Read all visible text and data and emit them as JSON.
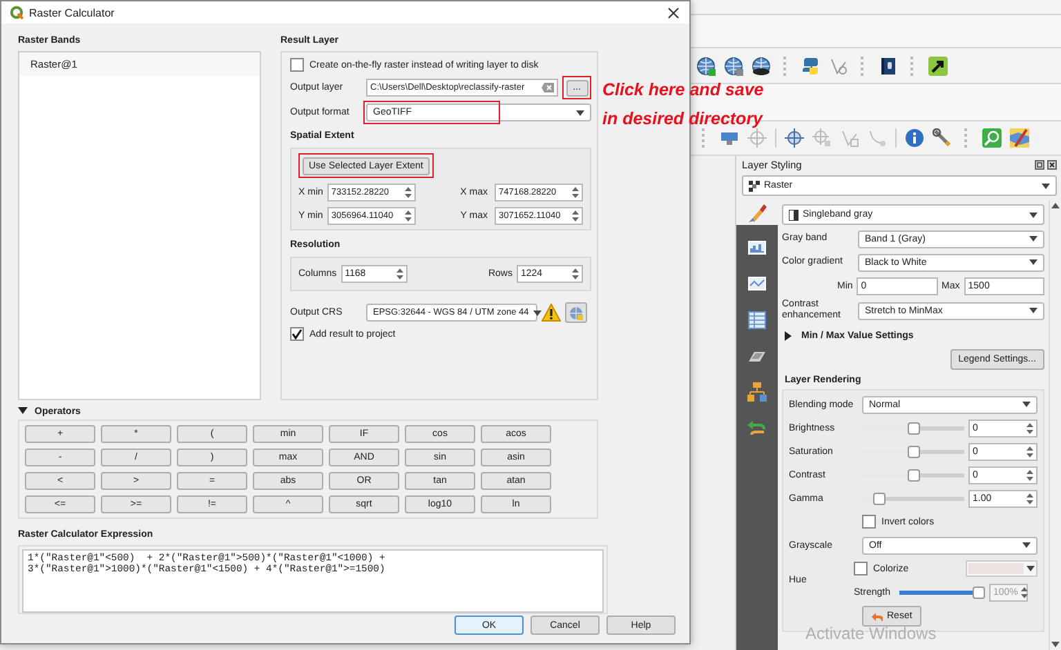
{
  "dialog": {
    "title": "Raster Calculator",
    "raster_bands": {
      "heading": "Raster Bands",
      "items": [
        {
          "label": "Raster@1",
          "selected": false
        }
      ]
    },
    "result_layer": {
      "heading": "Result Layer",
      "on_the_fly": {
        "label": "Create on-the-fly raster instead of writing layer to disk",
        "checked": false
      },
      "output_layer": {
        "label": "Output layer",
        "value": "C:\\Users\\Dell\\Desktop\\reclassify-raster",
        "browse": "...",
        "browse_highlighted": true
      },
      "output_format": {
        "label": "Output format",
        "value": "GeoTIFF",
        "highlighted": true
      },
      "spatial_extent": {
        "heading": "Spatial Extent",
        "button": "Use Selected Layer Extent",
        "button_highlighted": true,
        "fields": [
          {
            "label": "X min",
            "value": "733152.28220"
          },
          {
            "label": "X max",
            "value": "747168.28220"
          },
          {
            "label": "Y min",
            "value": "3056964.11040"
          },
          {
            "label": "Y max",
            "value": "3071652.11040"
          }
        ]
      },
      "resolution": {
        "heading": "Resolution",
        "fields": [
          {
            "label": "Columns",
            "value": "1168"
          },
          {
            "label": "Rows",
            "value": "1224"
          }
        ]
      },
      "output_crs": {
        "label": "Output CRS",
        "value": "EPSG:32644 - WGS 84 / UTM zone 44"
      },
      "add_to_project": {
        "label": "Add result to project",
        "checked": true
      }
    },
    "operators": {
      "heading": "Operators",
      "expanded": true,
      "buttons": [
        "+",
        "*",
        "(",
        "min",
        "IF",
        "cos",
        "acos",
        "-",
        "/",
        ")",
        "max",
        "AND",
        "sin",
        "asin",
        "<",
        ">",
        "=",
        "abs",
        "OR",
        "tan",
        "atan",
        "<=",
        ">=",
        "!=",
        "^",
        "sqrt",
        "log10",
        "ln"
      ]
    },
    "expression": {
      "heading": "Raster Calculator Expression",
      "lines": [
        "1*(\"Raster@1\"<500)  + 2*(\"Raster@1\">500)*(\"Raster@1\"<1000) +",
        "3*(\"Raster@1\">1000)*(\"Raster@1\"<1500) + 4*(\"Raster@1\">=1500)"
      ]
    },
    "buttons": [
      {
        "label": "OK",
        "default": true
      },
      {
        "label": "Cancel",
        "default": false
      },
      {
        "label": "Help",
        "default": false
      }
    ]
  },
  "annotation": {
    "lines": [
      "Click here and save",
      "in desired directory"
    ]
  },
  "layer_styling": {
    "title": "Layer Styling",
    "layer": "Raster",
    "sidebar_tabs": [
      {
        "selected": true
      },
      {
        "selected": false
      },
      {
        "selected": false
      },
      {
        "selected": false
      },
      {
        "selected": false
      },
      {
        "selected": false
      },
      {
        "selected": false
      }
    ],
    "renderer": "Singleband gray",
    "rows": [
      {
        "kind": "combo",
        "label": "Gray band",
        "value": "Band 1 (Gray)"
      },
      {
        "kind": "combo",
        "label": "Color gradient",
        "value": "Black to White"
      },
      {
        "kind": "minmax",
        "min_label": "Min",
        "min": "0",
        "max_label": "Max",
        "max": "1500"
      },
      {
        "kind": "combo",
        "label": "Contrast enhancement",
        "value": "Stretch to MinMax"
      }
    ],
    "minmax_settings": {
      "label": "Min / Max Value Settings",
      "expanded": false
    },
    "legend_button": "Legend Settings...",
    "rendering": {
      "heading": "Layer Rendering",
      "blending": {
        "label": "Blending mode",
        "value": "Normal"
      },
      "sliders": [
        {
          "label": "Brightness",
          "level": 0.5,
          "value": "0"
        },
        {
          "label": "Saturation",
          "level": 0.5,
          "value": "0"
        },
        {
          "label": "Contrast",
          "level": 0.5,
          "value": "0"
        },
        {
          "label": "Gamma",
          "level": 0.13,
          "value": "1.00"
        }
      ],
      "invert": {
        "label": "Invert colors",
        "checked": false
      },
      "grayscale": {
        "label": "Grayscale",
        "value": "Off"
      },
      "hue": {
        "label": "Hue",
        "colorize": {
          "label": "Colorize",
          "checked": false
        },
        "strength": {
          "label": "Strength",
          "level": 1,
          "value": "100%",
          "disabled": true
        }
      },
      "reset": "Reset"
    }
  },
  "system_notice": "Activate Windows"
}
